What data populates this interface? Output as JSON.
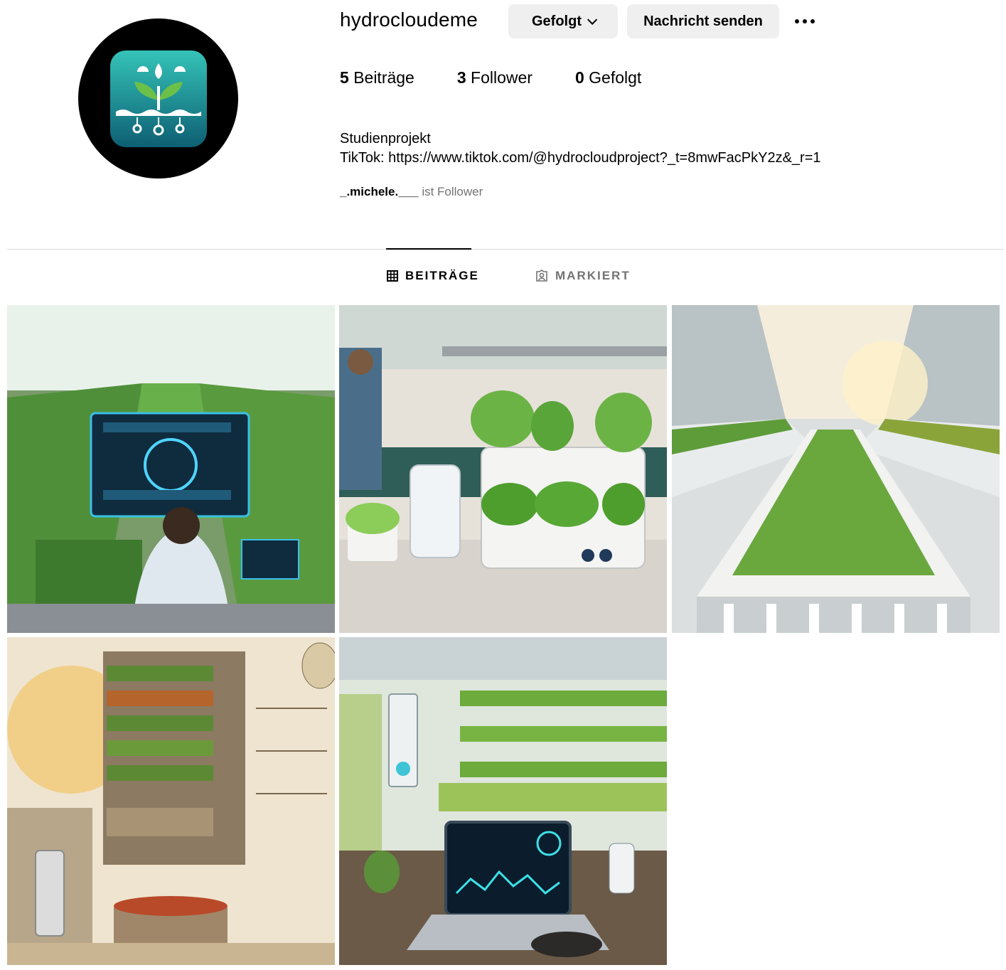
{
  "profile": {
    "username": "hydrocloudeme",
    "follow_button_label": "Gefolgt",
    "message_button_label": "Nachricht senden",
    "stats": {
      "posts_count": "5",
      "posts_label": "Beiträge",
      "followers_count": "3",
      "followers_label": "Follower",
      "following_count": "0",
      "following_label": "Gefolgt"
    },
    "bio_line1": "Studienprojekt",
    "bio_line2_prefix": "TikTok: ",
    "bio_link": "https://www.tiktok.com/@hydrocloudproject?_t=8mwFacPkY2z&_r=1",
    "followed_by_user": "_.michele.___",
    "followed_by_suffix": "ist Follower"
  },
  "tabs": [
    {
      "label": "BEITRÄGE",
      "icon": "grid-icon",
      "active": true
    },
    {
      "label": "MARKIERT",
      "icon": "tagged-icon",
      "active": false
    }
  ],
  "posts": [
    {
      "subject": "greenhouse-dashboard"
    },
    {
      "subject": "kitchen-hydroponic-unit"
    },
    {
      "subject": "greenhouse-rows"
    },
    {
      "subject": "vertical-garden-sketch"
    },
    {
      "subject": "vertical-farm-laptop"
    }
  ],
  "colors": {
    "button_bg": "#efefef",
    "secondary_text": "#737373",
    "divider": "#dbdbdb",
    "logo_teal": "#1a9fa0"
  }
}
